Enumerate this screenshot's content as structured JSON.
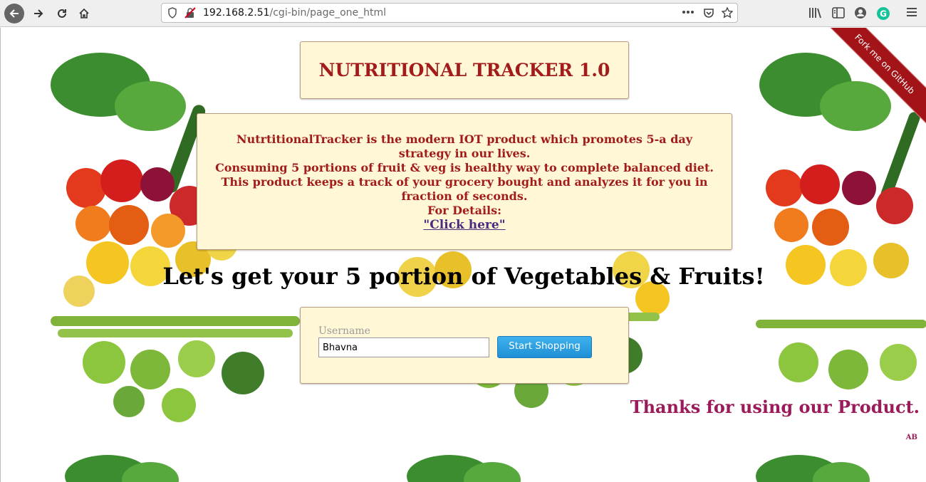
{
  "browser": {
    "url_host": "192.168.2.51",
    "url_path": "/cgi-bin/page_one_html",
    "back_icon": "arrow-left-icon",
    "forward_icon": "arrow-right-icon",
    "reload_icon": "reload-icon",
    "home_icon": "home-icon"
  },
  "ribbon": {
    "label": "Fork me on GitHub"
  },
  "header": {
    "title": "NUTRITIONAL TRACKER 1.0"
  },
  "description": {
    "line1": "NutrtitionalTracker is the modern IOT product which promotes 5-a day strategy in our lives.",
    "line2": "Consuming 5 portions of fruit & veg is healthy way to complete balanced diet.",
    "line3": "This product keeps a track of your grocery bought and analyzes it for you in fraction of seconds.",
    "details_label": "For Details:",
    "link_text": "\"Click here\""
  },
  "tagline": "Let's get your 5 portion of Vegetables & Fruits!",
  "login": {
    "username_label": "Username",
    "username_value": "Bhavna",
    "button_label": "Start Shopping"
  },
  "footer": {
    "thanks": "Thanks for using our Product.",
    "initials": "AB"
  },
  "colors": {
    "panel_bg": "#fff7d6",
    "title_text": "#a21c1c",
    "link": "#4b2a80",
    "button": "#2a9fe0",
    "thanks_text": "#9b1b5a",
    "ribbon": "#a21418"
  }
}
